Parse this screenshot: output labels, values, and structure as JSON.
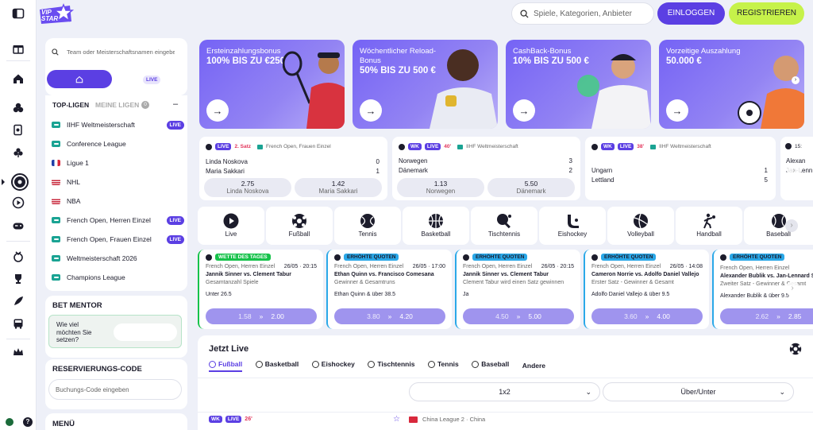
{
  "header": {
    "logo_text": "VIP STAR",
    "search_placeholder": "Spiele, Kategorien, Anbieter",
    "login_label": "EINLOGGEN",
    "register_label": "REGISTRIEREN"
  },
  "sidebar": {
    "search_placeholder": "Team oder Meisterschaftsnamen eingeben",
    "toggle_live": "LIVE",
    "tab_top": "TOP-LIGEN",
    "tab_mine": "MEINE LIGEN",
    "mine_count": "0",
    "leagues": [
      {
        "label": "IIHF Weltmeisterschaft",
        "live": "LIVE",
        "icon": "league-icon"
      },
      {
        "label": "Conference League",
        "live": "",
        "icon": "league-icon"
      },
      {
        "label": "Ligue 1",
        "live": "",
        "icon": "france-flag"
      },
      {
        "label": "NHL",
        "live": "",
        "icon": "usa-flag"
      },
      {
        "label": "NBA",
        "live": "",
        "icon": "usa-flag"
      },
      {
        "label": "French Open, Herren Einzel",
        "live": "LIVE",
        "icon": "league-icon"
      },
      {
        "label": "French Open, Frauen Einzel",
        "live": "LIVE",
        "icon": "league-icon"
      },
      {
        "label": "Weltmeisterschaft 2026",
        "live": "",
        "icon": "league-icon"
      },
      {
        "label": "Champions League",
        "live": "",
        "icon": "league-icon"
      }
    ],
    "bet_mentor_title": "BET MENTOR",
    "bet_mentor_question": "Wie viel möchten Sie setzen?",
    "reservation_title": "RESERVIERUNGS-CODE",
    "reservation_placeholder": "Buchungs-Code eingeben",
    "menu_title": "MENÜ"
  },
  "promos": [
    {
      "title": "Ersteinzahlungsbonus",
      "value": "100% BIS ZU €250"
    },
    {
      "title": "Wöchentlicher Reload-Bonus",
      "value": "50% BIS ZU 500 €"
    },
    {
      "title": "CashBack-Bonus",
      "value": "10% BIS ZU 500 €"
    },
    {
      "title": "Vorzeitige Auszahlung",
      "value": "50.000 €"
    }
  ],
  "live_matches": [
    {
      "badge": "LIVE",
      "status": "2. Satz",
      "league": "French Open, Frauen Einzel",
      "team1": "Linda Noskova",
      "team2": "Maria Sakkari",
      "score1": "0",
      "score2": "1",
      "odd1": "2.75",
      "odd1_label": "Linda Noskova",
      "odd2": "1.42",
      "odd2_label": "Maria Sakkari"
    },
    {
      "wk": "WK",
      "badge": "LIVE",
      "status": "40'",
      "league": "IIHF Weltmeisterschaft",
      "team1": "Norwegen",
      "team2": "Dänemark",
      "score1": "3",
      "score2": "2",
      "odd1": "1.13",
      "odd1_label": "Norwegen",
      "odd2": "5.50",
      "odd2_label": "Dänemark"
    },
    {
      "wk": "WK",
      "badge": "LIVE",
      "status": "38'",
      "league": "IIHF Weltmeisterschaft",
      "team1": "Ungarn",
      "team2": "Lettland",
      "score1": "1",
      "score2": "5"
    },
    {
      "status": "15:",
      "team1": "Alexan",
      "team2": "Jan-Lenn"
    }
  ],
  "sports": [
    {
      "label": "Live",
      "icon": "live-play-icon"
    },
    {
      "label": "Fußball",
      "icon": "soccer-ball-icon"
    },
    {
      "label": "Tennis",
      "icon": "tennis-ball-icon"
    },
    {
      "label": "Basketball",
      "icon": "basketball-icon"
    },
    {
      "label": "Tischtennis",
      "icon": "table-tennis-icon"
    },
    {
      "label": "Eishockey",
      "icon": "hockey-icon"
    },
    {
      "label": "Volleyball",
      "icon": "volleyball-icon"
    },
    {
      "label": "Handball",
      "icon": "handball-icon"
    },
    {
      "label": "Baseball",
      "icon": "baseball-icon"
    }
  ],
  "featured_bets": [
    {
      "label": "WETTE DES TAGES",
      "label_color": "#16c24a",
      "league": "French Open, Herren Einzel",
      "date": "26/05 · 20:15",
      "match": "Jannik Sinner vs. Clement Tabur",
      "market": "Gesamtanzahl Spiele",
      "pick": "Unter 26.5",
      "old": "1.58",
      "new": "2.00"
    },
    {
      "label": "ERHÖHTE QUOTEN",
      "label_color": "#2aa8e8",
      "league": "French Open, Herren Einzel",
      "date": "26/05 · 17:00",
      "match": "Ethan Quinn vs. Francisco Comesana",
      "market": "Gewinner & Gesamtruns",
      "pick": "Ethan Quinn & über 38.5",
      "old": "3.80",
      "new": "4.20"
    },
    {
      "label": "ERHÖHTE QUOTEN",
      "label_color": "#2aa8e8",
      "league": "French Open, Herren Einzel",
      "date": "26/05 · 20:15",
      "match": "Jannik Sinner vs. Clement Tabur",
      "market": "Clement Tabur wird einen Satz gewinnen",
      "pick": "Ja",
      "old": "4.50",
      "new": "5.00"
    },
    {
      "label": "ERHÖHTE QUOTEN",
      "label_color": "#2aa8e8",
      "league": "French Open, Herren Einzel",
      "date": "26/05 · 14:08",
      "match": "Cameron Norrie vs. Adolfo Daniel Vallejo",
      "market": "Erster Satz - Gewinner & Gesamt",
      "pick": "Adolfo Daniel Vallejo & über 9.5",
      "old": "3.60",
      "new": "4.00"
    },
    {
      "label": "ERHÖHTE QUOTEN",
      "label_color": "#2aa8e8",
      "league": "French Open, Herren Einzel",
      "date": "",
      "match": "Alexander Bublik vs. Jan-Lennard S",
      "market": "Zweiter Satz - Gewinner & Gesamt",
      "pick": "Alexander Bublik & über 9.5",
      "old": "2.62",
      "new": "2.85"
    }
  ],
  "jetzt_live": {
    "title": "Jetzt Live",
    "tabs": [
      "Fußball",
      "Basketball",
      "Eishockey",
      "Tischtennis",
      "Tennis",
      "Baseball",
      "Andere"
    ],
    "market1": "1x2",
    "market2": "Über/Unter",
    "row_wk": "WK",
    "row_badge": "LIVE",
    "row_minute": "26'",
    "row_league": "China League 2 · China"
  },
  "colors": {
    "accent": "#5b3fe3",
    "register": "#c6f24a",
    "live_red": "#e2345a",
    "promo": "#7b6cf2"
  }
}
